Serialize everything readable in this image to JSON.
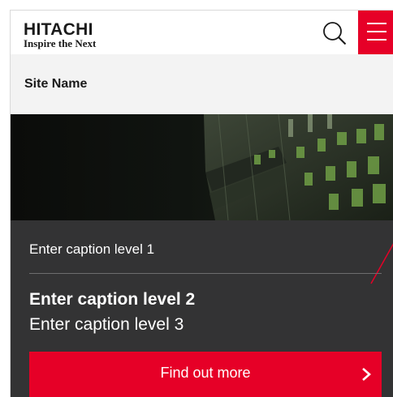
{
  "header": {
    "logo_word": "HITACHI",
    "logo_tagline": "Inspire the Next",
    "search_icon": "search-icon",
    "menu_icon": "hamburger-menu-icon"
  },
  "site": {
    "name": "Site Name"
  },
  "caption": {
    "level1": "Enter caption level 1",
    "level2": "Enter caption level 2",
    "level3": "Enter caption level 3",
    "cta_label": "Find out more",
    "cta_icon": "chevron-right-icon"
  },
  "colors": {
    "brand_red": "#e60027",
    "caption_bg": "#333334",
    "site_bar_bg": "#f3f3f3"
  }
}
